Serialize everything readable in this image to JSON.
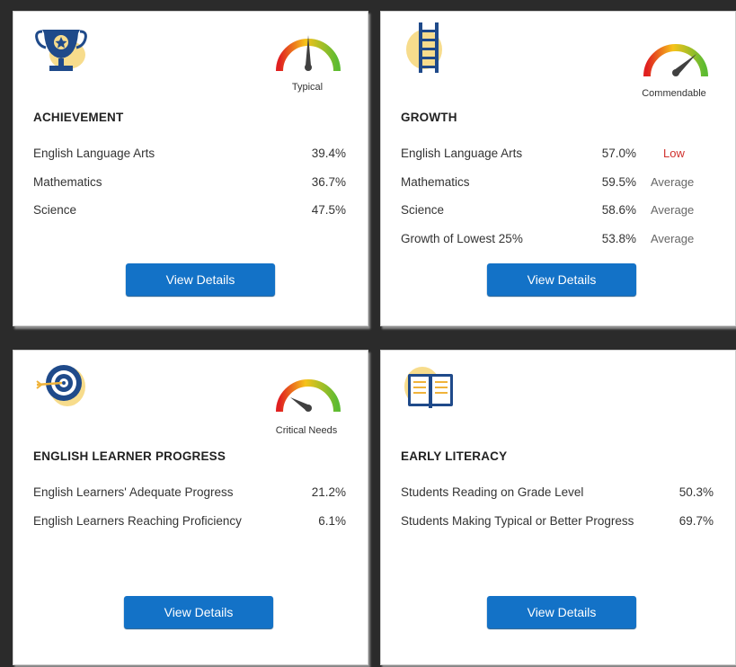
{
  "cards": [
    {
      "title": "ACHIEVEMENT",
      "gauge_label": "Typical",
      "icon": "trophy-icon",
      "rows": [
        {
          "label": "English Language Arts",
          "value": "39.4%"
        },
        {
          "label": "Mathematics",
          "value": "36.7%"
        },
        {
          "label": "Science",
          "value": "47.5%"
        }
      ],
      "button": "View Details"
    },
    {
      "title": "GROWTH",
      "gauge_label": "Commendable",
      "icon": "ladder-icon",
      "rows": [
        {
          "label": "English Language Arts",
          "value": "57.0%",
          "rating": "Low"
        },
        {
          "label": "Mathematics",
          "value": "59.5%",
          "rating": "Average"
        },
        {
          "label": "Science",
          "value": "58.6%",
          "rating": "Average"
        },
        {
          "label": "Growth of Lowest 25%",
          "value": "53.8%",
          "rating": "Average"
        }
      ],
      "button": "View Details"
    },
    {
      "title": "ENGLISH LEARNER PROGRESS",
      "gauge_label": "Critical Needs",
      "icon": "target-icon",
      "rows": [
        {
          "label": "English Learners' Adequate Progress",
          "value": "21.2%"
        },
        {
          "label": "English Learners Reaching Proficiency",
          "value": "6.1%"
        }
      ],
      "button": "View Details"
    },
    {
      "title": "EARLY LITERACY",
      "icon": "book-icon",
      "rows": [
        {
          "label": "Students Reading on Grade Level",
          "value": "50.3%"
        },
        {
          "label": "Students Making Typical or Better Progress",
          "value": "69.7%"
        }
      ],
      "button": "View Details"
    }
  ],
  "colors": {
    "button": "#1372c7",
    "rating_low": "#d0312d",
    "rating_average": "#666666",
    "icon_navy": "#1f4a8a",
    "icon_blob": "#f7dc8c"
  }
}
